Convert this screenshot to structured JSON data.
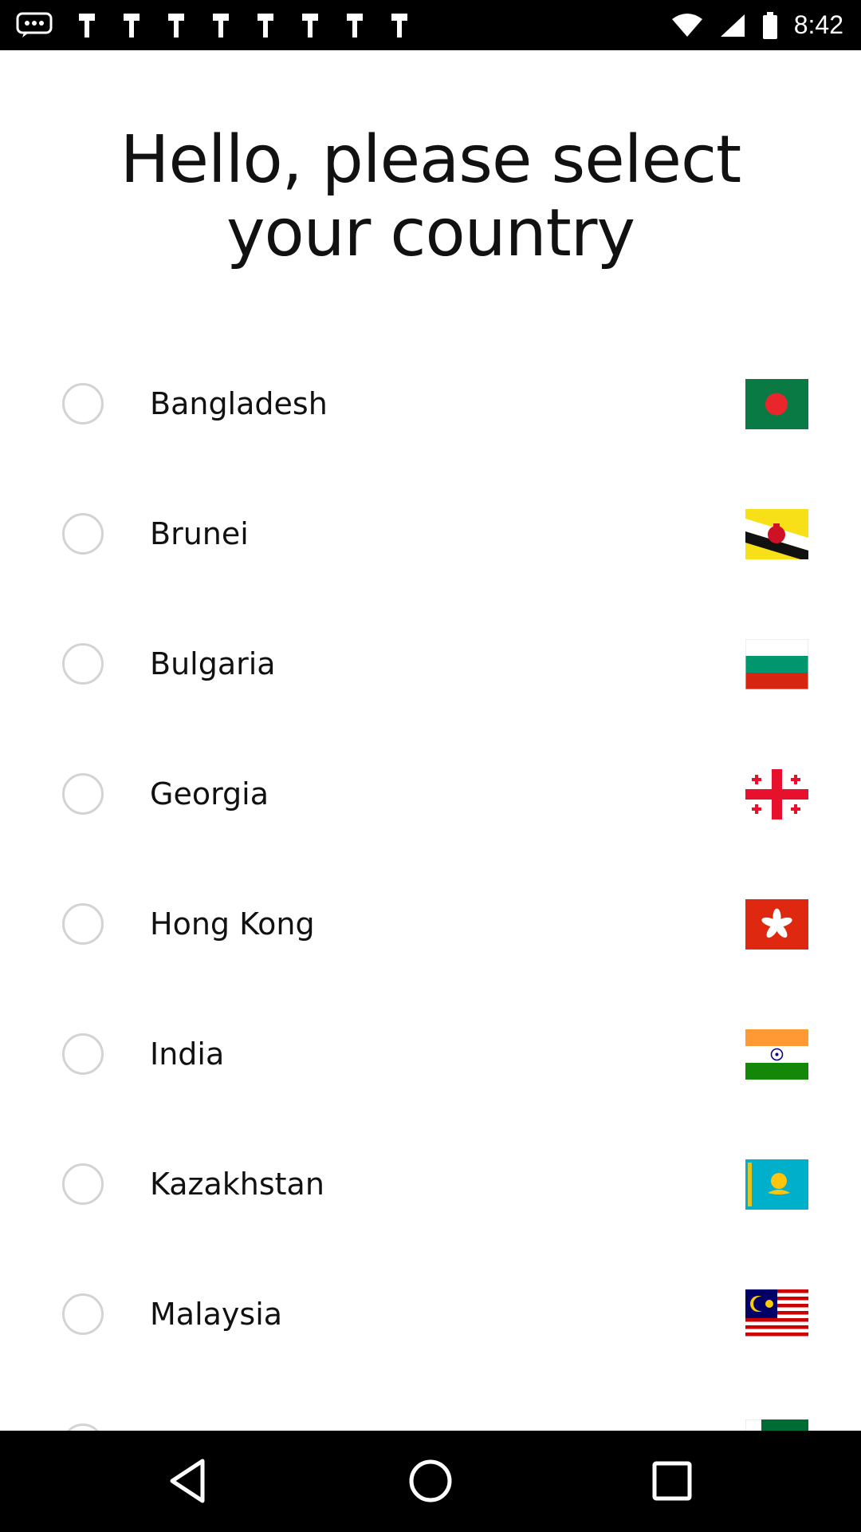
{
  "status_bar": {
    "time": "8:42",
    "notification_icons": [
      "chat-bubble-icon",
      "notification-icon",
      "notification-icon",
      "notification-icon",
      "notification-icon",
      "notification-icon",
      "notification-icon",
      "notification-icon",
      "notification-icon"
    ],
    "system_icons": [
      "wifi-icon",
      "signal-icon",
      "battery-icon"
    ]
  },
  "header": {
    "title": "Hello, please select your country"
  },
  "countries": [
    {
      "name": "Bangladesh",
      "flag": "bangladesh-flag-icon",
      "selected": false
    },
    {
      "name": "Brunei",
      "flag": "brunei-flag-icon",
      "selected": false
    },
    {
      "name": "Bulgaria",
      "flag": "bulgaria-flag-icon",
      "selected": false
    },
    {
      "name": "Georgia",
      "flag": "georgia-flag-icon",
      "selected": false
    },
    {
      "name": "Hong Kong",
      "flag": "hong-kong-flag-icon",
      "selected": false
    },
    {
      "name": "India",
      "flag": "india-flag-icon",
      "selected": false
    },
    {
      "name": "Kazakhstan",
      "flag": "kazakhstan-flag-icon",
      "selected": false
    },
    {
      "name": "Malaysia",
      "flag": "malaysia-flag-icon",
      "selected": false
    },
    {
      "name": "",
      "flag": "partial-flag-icon",
      "selected": false
    }
  ],
  "nav_bar": {
    "buttons": [
      "back-icon",
      "home-icon",
      "recents-icon"
    ]
  },
  "colors": {
    "background": "#ffffff",
    "text": "#111111",
    "radio_border": "#d3d3d3",
    "system_bars": "#000000"
  }
}
